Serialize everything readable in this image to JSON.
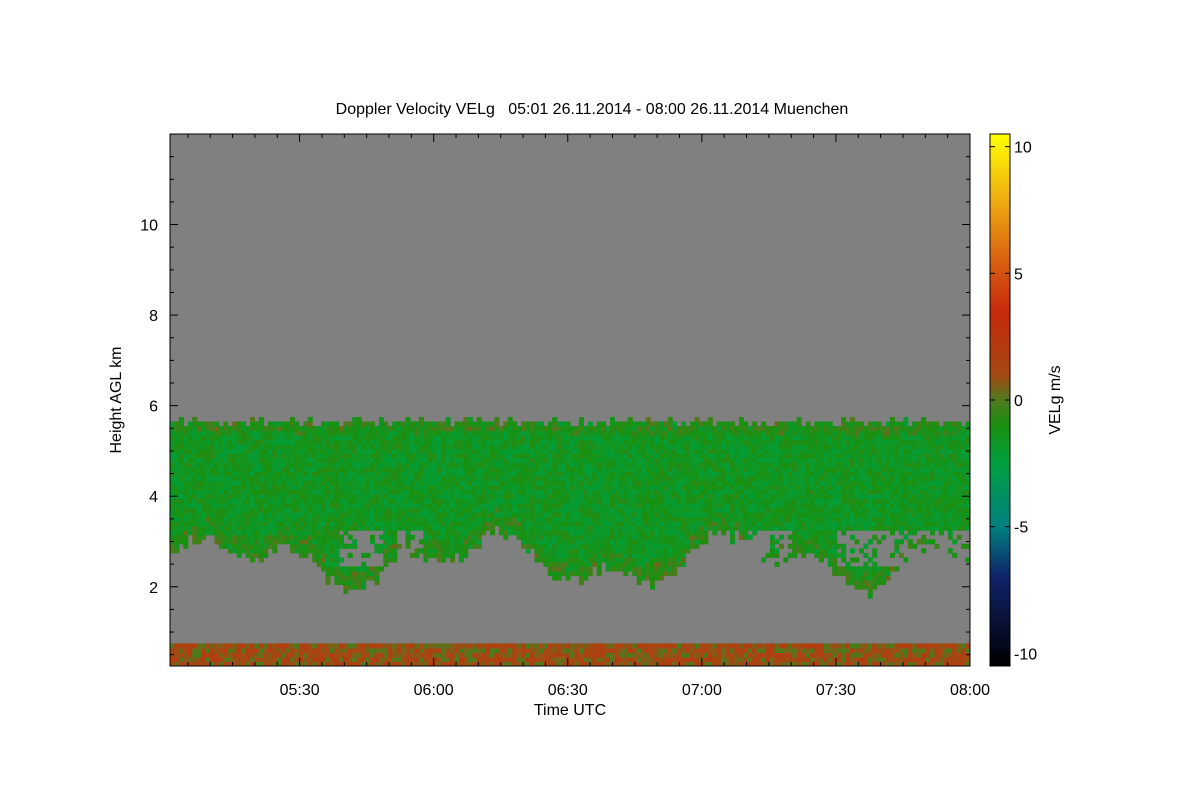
{
  "chart_data": {
    "type": "heatmap",
    "title": "Doppler Velocity VELg   05:01 26.11.2014 - 08:00 26.11.2014 Muenchen",
    "xlabel": "Time UTC",
    "ylabel": "Height AGL km",
    "colorbar_label": "VELg m/s",
    "x_range": [
      "05:01",
      "08:00"
    ],
    "x_tick_labels": [
      "05:30",
      "06:00",
      "06:30",
      "07:00",
      "07:30",
      "08:00"
    ],
    "x_tick_minutes": [
      30,
      60,
      90,
      120,
      150,
      180
    ],
    "x_start_minute": 1,
    "x_end_minute": 180,
    "ylim": [
      0.25,
      12.0
    ],
    "y_ticks": [
      2,
      4,
      6,
      8,
      10
    ],
    "y_tick_labels": [
      "2",
      "4",
      "6",
      "8",
      "10"
    ],
    "color_range": [
      -10.5,
      10.5
    ],
    "colorbar_ticks": [
      10,
      5,
      0,
      -5,
      -10
    ],
    "colorbar_tick_labels": [
      "10",
      "5",
      "0",
      "-5",
      "-10"
    ],
    "colormap": [
      {
        "value": -10.5,
        "color": "#000000"
      },
      {
        "value": -7.0,
        "color": "#10226a"
      },
      {
        "value": -5.0,
        "color": "#007f80"
      },
      {
        "value": -2.5,
        "color": "#00a040"
      },
      {
        "value": -1.0,
        "color": "#1a9010"
      },
      {
        "value": 0.0,
        "color": "#4f7a1e"
      },
      {
        "value": 1.0,
        "color": "#a54812"
      },
      {
        "value": 3.5,
        "color": "#c72a0c"
      },
      {
        "value": 5.5,
        "color": "#d86010"
      },
      {
        "value": 8.0,
        "color": "#f0b010"
      },
      {
        "value": 10.5,
        "color": "#ffff00"
      }
    ],
    "no_signal_color": "#808080",
    "regions": [
      {
        "feature": "cloud layer",
        "t_start": 1,
        "t_end": 180,
        "z_bottom_min": 1.8,
        "z_bottom_max": 3.2,
        "z_top": 5.6,
        "velocity_typical": -1.5
      },
      {
        "feature": "near-surface layer",
        "t_start": 1,
        "t_end": 180,
        "z_bottom": 0.25,
        "z_top": 0.7,
        "velocity_typical": 0.5
      },
      {
        "feature": "clear-air gaps",
        "z_range": [
          2.4,
          3.2
        ],
        "times": [
          [
            38,
            48
          ],
          [
            51,
            57
          ],
          [
            127,
            140
          ],
          [
            150,
            180
          ]
        ]
      }
    ]
  }
}
